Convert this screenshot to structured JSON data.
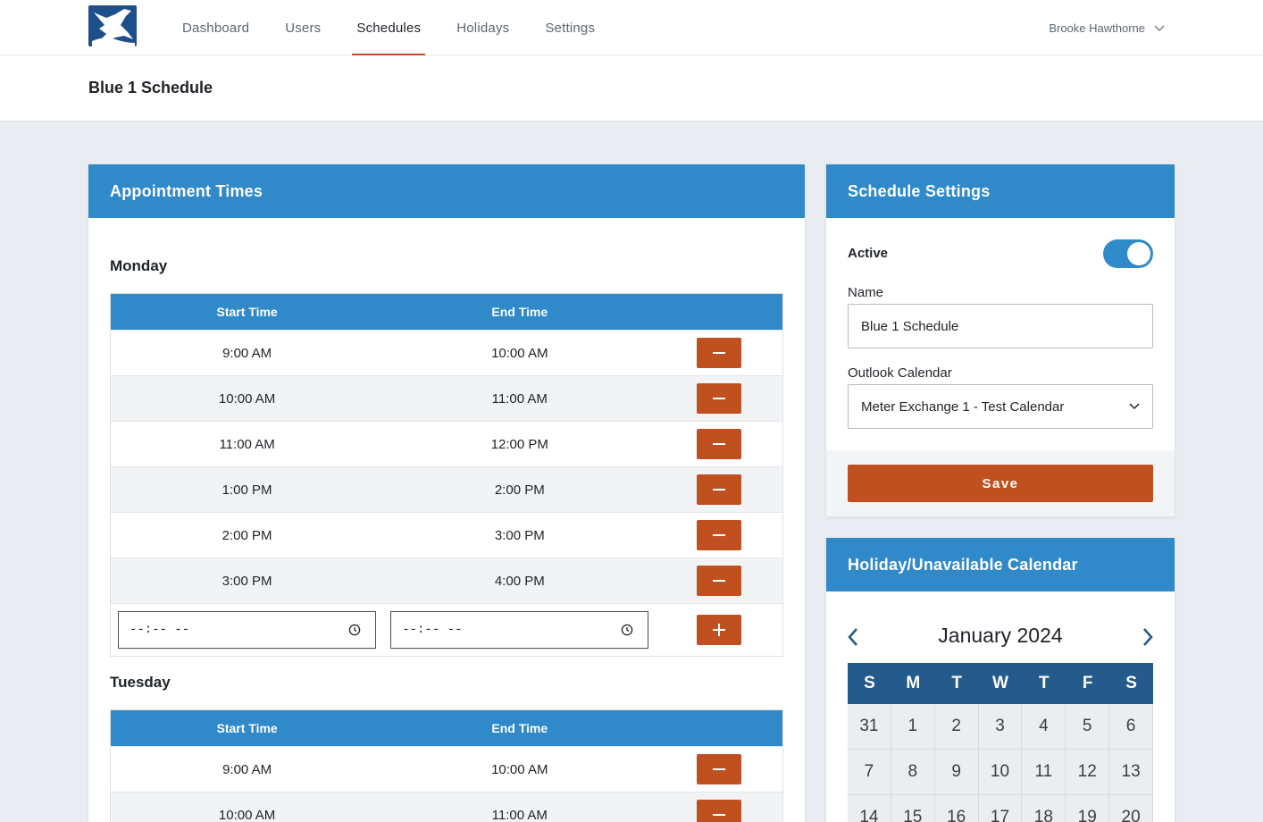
{
  "nav": {
    "items": [
      {
        "label": "Dashboard",
        "active": false
      },
      {
        "label": "Users",
        "active": false
      },
      {
        "label": "Schedules",
        "active": true
      },
      {
        "label": "Holidays",
        "active": false
      },
      {
        "label": "Settings",
        "active": false
      }
    ],
    "user_name": "Brooke Hawthorne"
  },
  "page": {
    "title": "Blue 1 Schedule"
  },
  "appointments": {
    "title": "Appointment Times",
    "columns": {
      "start": "Start Time",
      "end": "End Time"
    },
    "days": [
      {
        "name": "Monday",
        "slots": [
          {
            "start": "9:00 AM",
            "end": "10:00 AM"
          },
          {
            "start": "10:00 AM",
            "end": "11:00 AM"
          },
          {
            "start": "11:00 AM",
            "end": "12:00 PM"
          },
          {
            "start": "1:00 PM",
            "end": "2:00 PM"
          },
          {
            "start": "2:00 PM",
            "end": "3:00 PM"
          },
          {
            "start": "3:00 PM",
            "end": "4:00 PM"
          }
        ],
        "new_start_placeholder": "--:-- --",
        "new_end_placeholder": "--:-- --"
      },
      {
        "name": "Tuesday",
        "slots": [
          {
            "start": "9:00 AM",
            "end": "10:00 AM"
          },
          {
            "start": "10:00 AM",
            "end": "11:00 AM"
          }
        ]
      }
    ]
  },
  "settings": {
    "title": "Schedule Settings",
    "active_label": "Active",
    "active": true,
    "name_label": "Name",
    "name_value": "Blue 1 Schedule",
    "calendar_label": "Outlook Calendar",
    "calendar_value": "Meter Exchange 1 - Test Calendar",
    "save_label": "Save"
  },
  "calendar": {
    "title": "Holiday/Unavailable Calendar",
    "month_label": "January 2024",
    "weekdays": [
      "S",
      "M",
      "T",
      "W",
      "T",
      "F",
      "S"
    ],
    "days": [
      "31",
      "1",
      "2",
      "3",
      "4",
      "5",
      "6",
      "7",
      "8",
      "9",
      "10",
      "11",
      "12",
      "13",
      "14",
      "15",
      "16",
      "17",
      "18",
      "19",
      "20"
    ]
  },
  "colors": {
    "primary": "#3089c8",
    "accent": "#c0501f",
    "calendar_header": "#255a8c"
  },
  "icons": {
    "remove": "minus-icon",
    "add": "plus-icon",
    "clock": "clock-icon",
    "chevron": "chevron-down-icon"
  }
}
